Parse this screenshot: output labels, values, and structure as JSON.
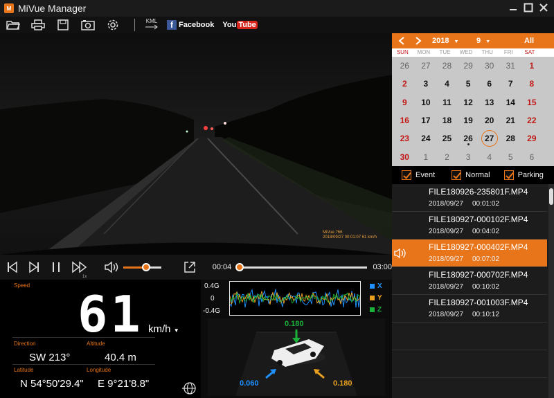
{
  "window": {
    "title": "MiVue Manager"
  },
  "toolbar": {
    "kml": "KML",
    "facebook": "Facebook",
    "youtube_you": "You",
    "youtube_tube": "Tube"
  },
  "video": {
    "watermark_line1": "MiVue 766",
    "watermark_line2": "2018/09/27  00:01:07  61 km/h",
    "watermark_line3": "N 54.8415  E 9.3691  E 21.8 N"
  },
  "playback": {
    "speed_multiplier": "1x",
    "volume_level": 0.6,
    "current_time": "00:04",
    "total_time": "03:00",
    "progress": 0.022
  },
  "info": {
    "speed_label": "Speed",
    "speed_value": "61",
    "speed_unit": "km/h",
    "direction_label": "Direction",
    "direction_value": "SW 213°",
    "altitude_label": "Altitude",
    "altitude_value": "40.4  m",
    "latitude_label": "Latitude",
    "latitude_value": "N 54°50'29.4\"",
    "longitude_label": "Longitude",
    "longitude_value": "E 9°21'8.8\""
  },
  "gsensor": {
    "y_ticks": [
      "0.4G",
      "0",
      "-0.4G"
    ],
    "legend": [
      {
        "label": "X",
        "color": "#1e90ff"
      },
      {
        "label": "Y",
        "color": "#e8a020"
      },
      {
        "label": "Z",
        "color": "#1bb03a"
      }
    ],
    "z_value": "0.180",
    "x_value": "0.060",
    "y_value": "0.180"
  },
  "calendar": {
    "year": "2018",
    "month": "9",
    "all_label": "All",
    "weekdays": [
      "SUN",
      "MON",
      "TUE",
      "WED",
      "THU",
      "FRI",
      "SAT"
    ],
    "days": [
      {
        "d": "26",
        "t": "grey"
      },
      {
        "d": "27",
        "t": "grey"
      },
      {
        "d": "28",
        "t": "grey"
      },
      {
        "d": "29",
        "t": "grey"
      },
      {
        "d": "30",
        "t": "grey"
      },
      {
        "d": "31",
        "t": "grey"
      },
      {
        "d": "1",
        "t": "red"
      },
      {
        "d": "2",
        "t": "red"
      },
      {
        "d": "3",
        "t": "n"
      },
      {
        "d": "4",
        "t": "n"
      },
      {
        "d": "5",
        "t": "n"
      },
      {
        "d": "6",
        "t": "n"
      },
      {
        "d": "7",
        "t": "n"
      },
      {
        "d": "8",
        "t": "red"
      },
      {
        "d": "9",
        "t": "red"
      },
      {
        "d": "10",
        "t": "n"
      },
      {
        "d": "11",
        "t": "n"
      },
      {
        "d": "12",
        "t": "n"
      },
      {
        "d": "13",
        "t": "n"
      },
      {
        "d": "14",
        "t": "n"
      },
      {
        "d": "15",
        "t": "red"
      },
      {
        "d": "16",
        "t": "red"
      },
      {
        "d": "17",
        "t": "n"
      },
      {
        "d": "18",
        "t": "n"
      },
      {
        "d": "19",
        "t": "n"
      },
      {
        "d": "20",
        "t": "n"
      },
      {
        "d": "21",
        "t": "n"
      },
      {
        "d": "22",
        "t": "red"
      },
      {
        "d": "23",
        "t": "red"
      },
      {
        "d": "24",
        "t": "n"
      },
      {
        "d": "25",
        "t": "n"
      },
      {
        "d": "26",
        "t": "dot"
      },
      {
        "d": "27",
        "t": "sel"
      },
      {
        "d": "28",
        "t": "n"
      },
      {
        "d": "29",
        "t": "red"
      },
      {
        "d": "30",
        "t": "red"
      },
      {
        "d": "1",
        "t": "grey"
      },
      {
        "d": "2",
        "t": "grey"
      },
      {
        "d": "3",
        "t": "grey"
      },
      {
        "d": "4",
        "t": "grey"
      },
      {
        "d": "5",
        "t": "grey"
      },
      {
        "d": "6",
        "t": "grey"
      }
    ]
  },
  "filters": {
    "event": "Event",
    "normal": "Normal",
    "parking": "Parking"
  },
  "files": [
    {
      "name": "FILE180926-235801F.MP4",
      "date": "2018/09/27",
      "time": "00:01:02",
      "active": false
    },
    {
      "name": "FILE180927-000102F.MP4",
      "date": "2018/09/27",
      "time": "00:04:02",
      "active": false
    },
    {
      "name": "FILE180927-000402F.MP4",
      "date": "2018/09/27",
      "time": "00:07:02",
      "active": true
    },
    {
      "name": "FILE180927-000702F.MP4",
      "date": "2018/09/27",
      "time": "00:10:02",
      "active": false
    },
    {
      "name": "FILE180927-001003F.MP4",
      "date": "2018/09/27",
      "time": "00:10:12",
      "active": false
    }
  ]
}
